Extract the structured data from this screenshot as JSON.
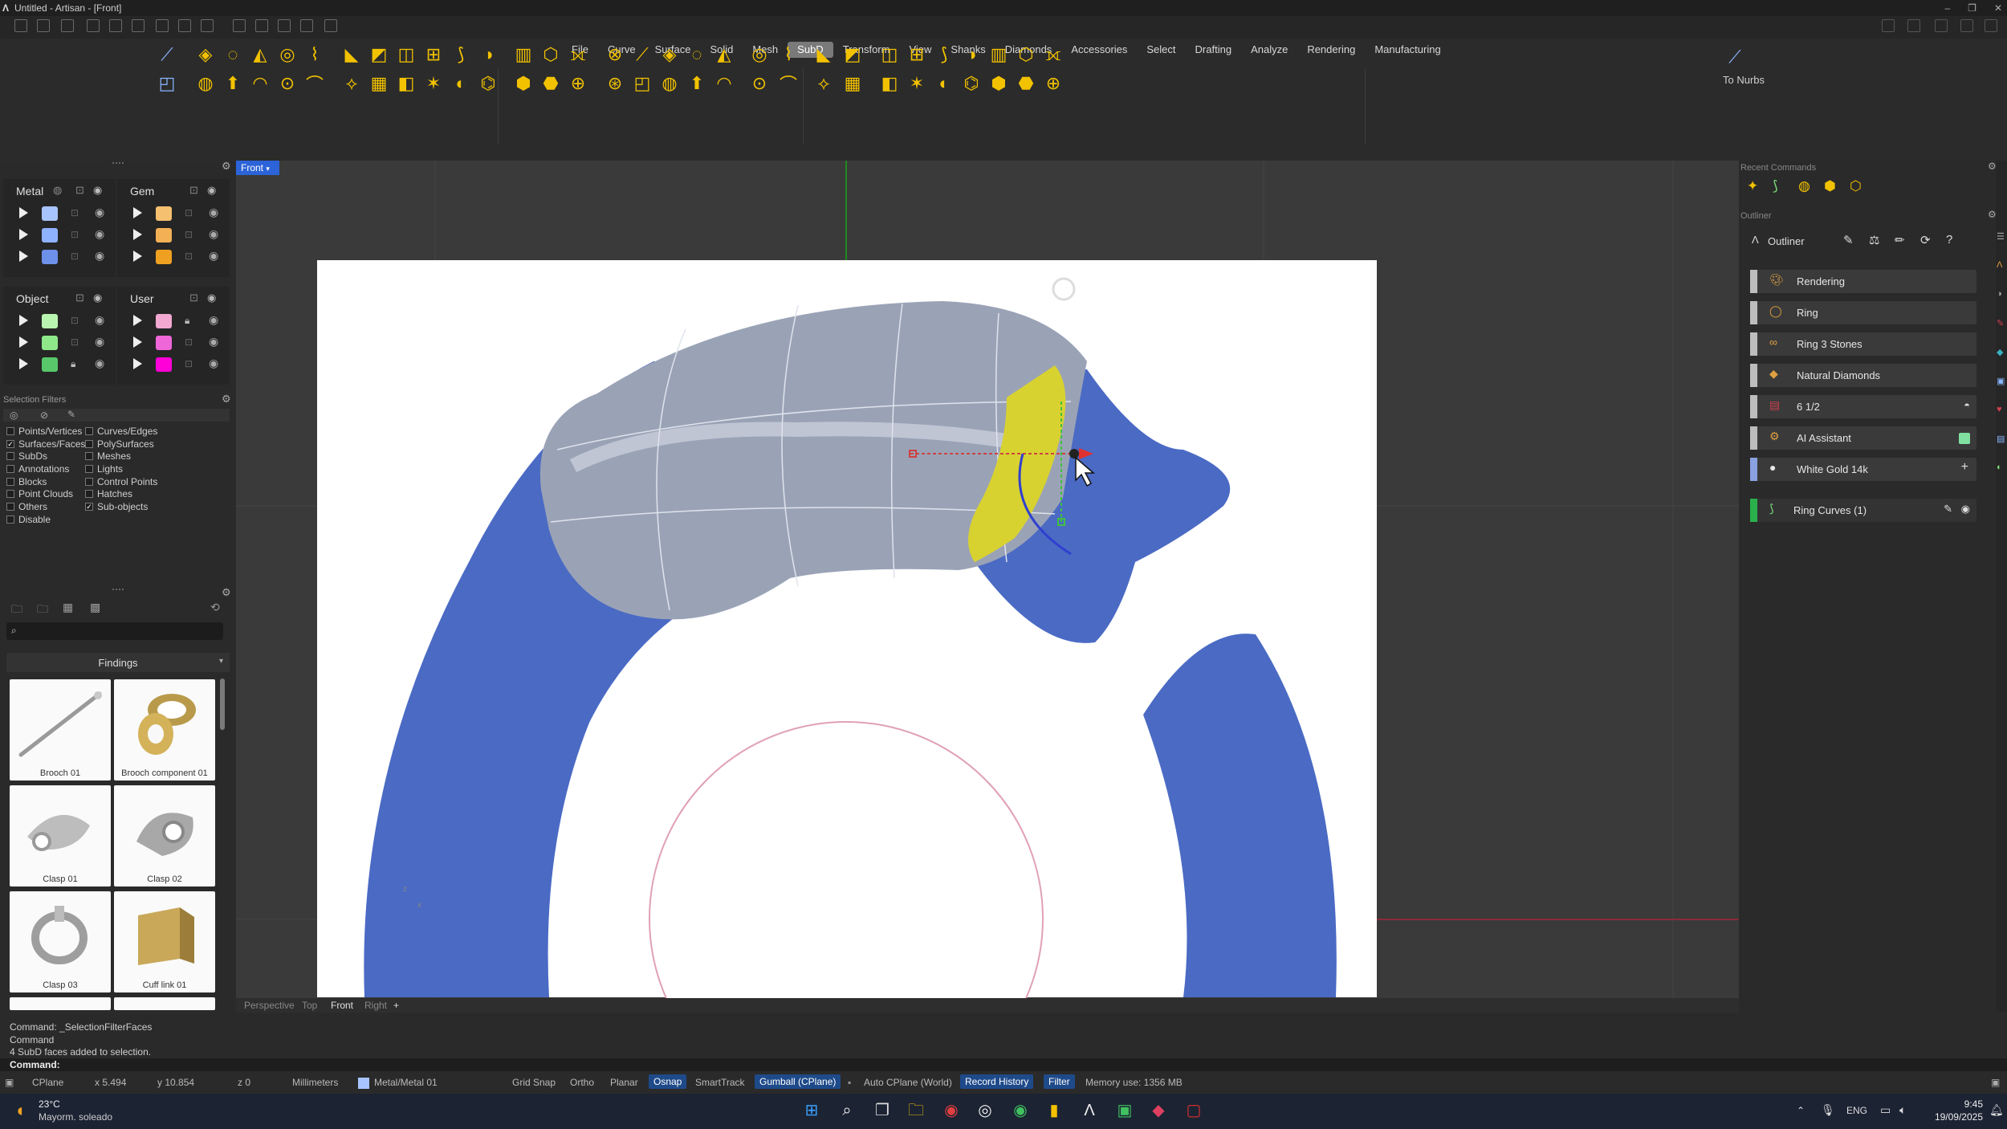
{
  "titlebar": {
    "title": "Untitled - Artisan - [Front]"
  },
  "menu": [
    "File",
    "Curve",
    "Surface",
    "Solid",
    "Mesh",
    "SubD",
    "Transform",
    "View",
    "Shanks",
    "Diamonds",
    "Accessories",
    "Select",
    "Drafting",
    "Analyze",
    "Rendering",
    "Manufacturing"
  ],
  "menu_active": "SubD",
  "ribbon": {
    "to_nurbs": "To Nurbs"
  },
  "layers": {
    "metal": {
      "title": "Metal",
      "colors": [
        "#a8c4ff",
        "#8fb2ff",
        "#6d90e8"
      ]
    },
    "gem": {
      "title": "Gem",
      "colors": [
        "#f5c070",
        "#f3b055",
        "#f0a020"
      ]
    },
    "object": {
      "title": "Object",
      "colors": [
        "#b8f5b0",
        "#8ee88a",
        "#58c86a"
      ]
    },
    "user": {
      "title": "User",
      "colors": [
        "#f2a8d0",
        "#ee66d8",
        "#ff00d8"
      ]
    }
  },
  "selection_filters": {
    "title": "Selection Filters",
    "col1": [
      "Points/Vertices",
      "Surfaces/Faces",
      "SubDs",
      "Annotations",
      "Blocks",
      "Point Clouds",
      "Others",
      "Disable"
    ],
    "col1_checked": [
      false,
      true,
      false,
      false,
      false,
      false,
      false,
      false
    ],
    "col2": [
      "Curves/Edges",
      "PolySurfaces",
      "Meshes",
      "Lights",
      "Control Points",
      "Hatches",
      "Sub-objects"
    ],
    "col2_checked": [
      false,
      false,
      false,
      false,
      false,
      false,
      true
    ]
  },
  "library": {
    "search_placeholder": "",
    "title": "Findings",
    "items": [
      "Brooch 01",
      "Brooch component 01",
      "Clasp 01",
      "Clasp 02",
      "Clasp 03",
      "Cuff link 01"
    ]
  },
  "viewport": {
    "active_tab": "Front",
    "tabs": [
      "Perspective",
      "Top",
      "Front",
      "Right",
      "+"
    ]
  },
  "right_panel": {
    "recent_commands": "Recent Commands",
    "outliner_section": "Outliner",
    "outliner_title": "Outliner",
    "rows": [
      {
        "label": "Rendering",
        "icon": "palette-icon"
      },
      {
        "label": "Ring",
        "icon": "ring-icon"
      },
      {
        "label": "Ring 3 Stones",
        "icon": "ring-stones-icon"
      },
      {
        "label": "Natural Diamonds",
        "icon": "diamond-icon"
      },
      {
        "label": "6 1/2",
        "icon": "us-flag-icon"
      },
      {
        "label": "AI Assistant",
        "icon": "ai-icon"
      },
      {
        "label": "White Gold 14k",
        "icon": "material-sphere-icon"
      },
      {
        "label": "Ring Curves (1)",
        "icon": "curve-icon"
      }
    ]
  },
  "command": {
    "history": [
      "Command: _SelectionFilterFaces",
      "Command",
      "4 SubD faces added to selection."
    ],
    "prompt": "Command:"
  },
  "status": {
    "cplane": "CPlane",
    "x": "x 5.494",
    "y": "y 10.854",
    "z": "z 0",
    "units": "Millimeters",
    "layer": "Metal/Metal 01",
    "grid_snap": "Grid Snap",
    "ortho": "Ortho",
    "planar": "Planar",
    "osnap": "Osnap",
    "smarttrack": "SmartTrack",
    "gumball": "Gumball (CPlane)",
    "auto_cplane": "Auto CPlane (World)",
    "record_history": "Record History",
    "filter": "Filter",
    "memory": "Memory use: 1356 MB"
  },
  "taskbar": {
    "weather_temp": "23°C",
    "weather_desc": "Mayorm. soleado",
    "lang": "ENG",
    "time": "9:45",
    "date": "19/09/2025"
  }
}
